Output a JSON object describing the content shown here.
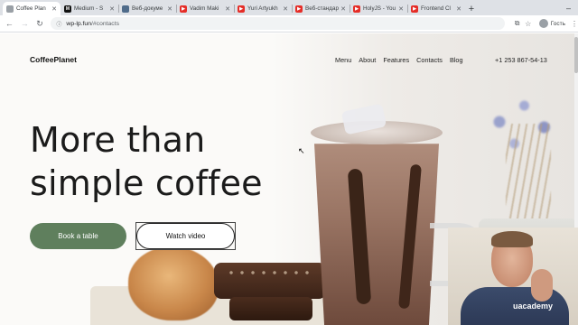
{
  "browser": {
    "tabs": [
      {
        "label": "Coffee Plan",
        "favicon": "globe",
        "fav_color": "#9aa0a6",
        "active": true
      },
      {
        "label": "Medium - S",
        "favicon": "M",
        "fav_color": "#111111",
        "active": false
      },
      {
        "label": "Веб-докуме",
        "favicon": "chrome",
        "fav_color": "#4f6b8a",
        "active": false
      },
      {
        "label": "Vadim Maki",
        "favicon": "youtube",
        "fav_color": "#e52d27",
        "active": false
      },
      {
        "label": "Yuri Artyukh",
        "favicon": "youtube",
        "fav_color": "#e52d27",
        "active": false
      },
      {
        "label": "Веб-стандар",
        "favicon": "youtube",
        "fav_color": "#e52d27",
        "active": false
      },
      {
        "label": "HolyJS - You",
        "favicon": "youtube",
        "fav_color": "#e52d27",
        "active": false
      },
      {
        "label": "Frontend Cl",
        "favicon": "youtube",
        "fav_color": "#e52d27",
        "active": false
      }
    ],
    "new_tab": "+",
    "minimize": "–",
    "url_host": "wp-lp.fun",
    "url_path": "/#contacts",
    "profile_label": "Гость"
  },
  "site": {
    "logo": "CoffeePlanet",
    "nav": [
      "Menu",
      "About",
      "Features",
      "Contacts",
      "Blog"
    ],
    "phone": "+1 253 867-54-13",
    "hero_line1": "More than",
    "hero_line2": "simple coffee",
    "primary_button": "Book a table",
    "secondary_button": "Watch video",
    "accent_color": "#5f7f5d"
  },
  "overlay": {
    "watermark": "uacademy"
  }
}
